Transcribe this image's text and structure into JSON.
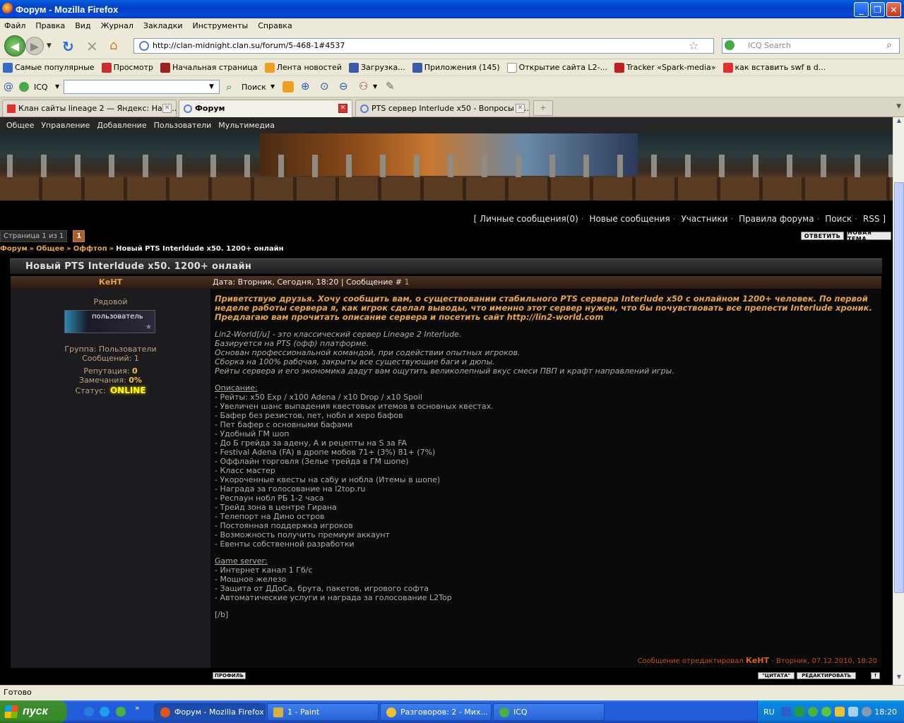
{
  "window": {
    "title": "Форум - Mozilla Firefox"
  },
  "menu": [
    "Файл",
    "Правка",
    "Вид",
    "Журнал",
    "Закладки",
    "Инструменты",
    "Справка"
  ],
  "nav": {
    "url": "http://clan-midnight.clan.su/forum/5-468-1#4537",
    "search_placeholder": "ICQ Search"
  },
  "bookmarks": [
    "Самые популярные",
    "Просмотр",
    "Начальная страница",
    "Лента новостей",
    "Загрузка...",
    "Приложения (145)",
    "Открытие сайта L2-...",
    "Tracker «Spark-media»",
    "как вставить swf в d..."
  ],
  "icq_toolbar": {
    "label": "ICQ",
    "search_label": "Поиск"
  },
  "tabs": [
    {
      "label": "Клан сайты lineage 2 — Яндекс: Наш..."
    },
    {
      "label": "Форум"
    },
    {
      "label": "PTS сервер Interlude x50 - Вопросы и ..."
    }
  ],
  "forum": {
    "topnav": [
      "Общее",
      "Управление",
      "Добавление",
      "Пользователи",
      "Мультимедиа"
    ],
    "userlinks": {
      "lb": "[",
      "items": [
        "Личные сообщения(0)",
        "Новые сообщения",
        "Участники",
        "Правила форума",
        "Поиск",
        "RSS"
      ],
      "rb": "]"
    },
    "pagination": {
      "label": "Страница 1 из 1",
      "current": "1"
    },
    "buttons": {
      "reply": "ОТВЕТИТЬ",
      "new_topic": "НОВАЯ ТЕМА",
      "profile": "ПРОФИЛЬ",
      "quote": "\"ЦИТАТА\"",
      "edit": "РЕДАКТИРОВАТЬ",
      "top": "↑"
    },
    "breadcrumb": {
      "forum": "Форум",
      "general": "Общее",
      "offtop": "Оффтоп",
      "topic": "Новый PTS Interldude x50. 1200+ онлайн"
    },
    "thread_title": "Новый PTS Interldude x50. 1200+ онлайн",
    "author": {
      "name": "КеНТ",
      "rank": "Рядовой",
      "badge": "пользователь",
      "group": "Группа: Пользователи",
      "messages": "Сообщений: 1",
      "rep_label": "Репутация:",
      "rep_value": "0",
      "warn_label": "Замечания:",
      "warn_value": "0%",
      "status_label": "Статус:",
      "status_value": "ONLINE"
    },
    "post": {
      "date_text": "Дата: Вторник, Сегодня, 18:20 | Сообщение #",
      "msg_num": "1",
      "intro": "Приветствую друзья. Хочу сообщить вам, о существовании стабильного PTS сервера Interlude x50 с онлайном 1200+ человек. По первой неделе работы сервера я, как игрок сделал выводы, что именно этот сервер нужен, что бы почувствовать все препести Interlude хроник. Предлагаю вам прочитать описание сервера и посетить сайт http://lin2-world.com",
      "about": [
        "Lin2-World[/u] - это классический сервер Lineage 2 Interlude.",
        "Базируется на PTS (офф) платформе.",
        "Основан профессиональной командой, при содействии опытных игроков.",
        "Сборка на 100% рабочая, закрыты все существующие баги и дюпы.",
        "Рейты сервера и его экономика дадут вам ощутить великолепный вкус смеси ПВП и крафт направлений игры."
      ],
      "desc_title": "Описание:",
      "desc": [
        "- Рейты: x50 Exp / x100 Adena / x10 Drop / x10 Spoil",
        "- Увеличен шанс выпадения квестовых итемов в основных квестах.",
        "- Бафер без резистов, пет, нобл и херо бафов",
        "- Пет бафер с основными бафами",
        "- Удобный ГМ шоп",
        "- До Б грейда за адену, А и рецепты на S за FA",
        "- Festival Adena (FA) в дропе мобов 71+ (3%) 81+ (7%)",
        "- Оффлайн торговля (Зелье трейда в ГМ шопе)",
        "- Класс мастер",
        "- Укороченные квесты на сабу и нобла (Итемы в шопе)",
        "- Награда за голосование на l2top.ru",
        "- Респаун нобл РБ 1-2 часа",
        "- Трейд зона в центре Гирана",
        "- Телепорт на Дино остров",
        "- Постоянная поддержка игроков",
        "- Возможность получить премиум аккаунт",
        "- Евенты собственной разработки"
      ],
      "server_title": "Game server:",
      "server": [
        "- Интернет канал 1 Гб/с",
        "- Мощное железо",
        "- Защита от ДДоСа, брута, пакетов, игрового софта",
        "- Автоматические услуги и награда за голосование L2Top"
      ],
      "closing": "[/b]",
      "edited_prefix": "Сообщение отредактировал",
      "edited_name": "КеНТ",
      "edited_suffix": "- Вторник, 07.12.2010, 18:20"
    }
  },
  "statusbar": "Готово",
  "taskbar": {
    "start": "пуск",
    "tasks": [
      "Форум - Mozilla Firefox",
      "1 - Paint",
      "Разговоров: 2 - Мих...",
      "ICQ"
    ],
    "lang": "RU",
    "clock": "18:20"
  }
}
